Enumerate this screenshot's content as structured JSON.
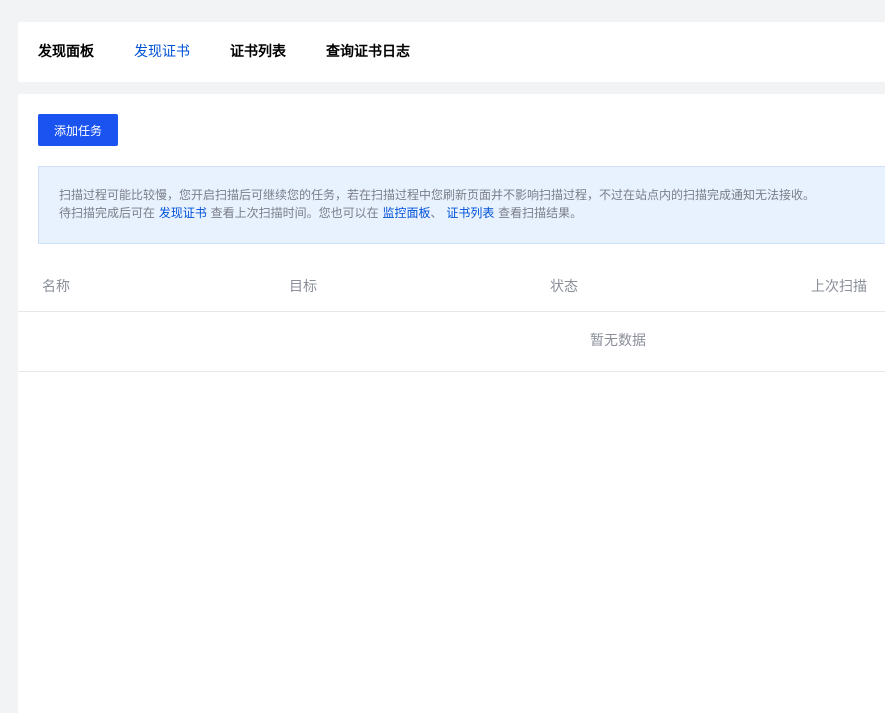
{
  "tabs": [
    {
      "label": "发现面板",
      "active": false
    },
    {
      "label": "发现证书",
      "active": true
    },
    {
      "label": "证书列表",
      "active": false
    },
    {
      "label": "查询证书日志",
      "active": false
    }
  ],
  "toolbar": {
    "add_task_label": "添加任务"
  },
  "notice": {
    "line1": "扫描过程可能比较慢，您开启扫描后可继续您的任务，若在扫描过程中您刷新页面并不影响扫描过程，不过在站点内的扫描完成通知无法接收。",
    "line2_prefix": "待扫描完成后可在 ",
    "link_discover_cert": "发现证书",
    "line2_middle": " 查看上次扫描时间。您也可以在 ",
    "link_monitor_panel": "监控面板",
    "separator": "、 ",
    "link_cert_list": "证书列表",
    "line2_suffix": " 查看扫描结果。"
  },
  "table": {
    "columns": [
      "名称",
      "目标",
      "状态",
      "上次扫描"
    ],
    "empty_text": "暂无数据"
  },
  "colors": {
    "accent": "#0052d9",
    "primary_button": "#1a53ef",
    "notice_bg": "#e8f1fe",
    "page_bg": "#f2f3f5"
  }
}
